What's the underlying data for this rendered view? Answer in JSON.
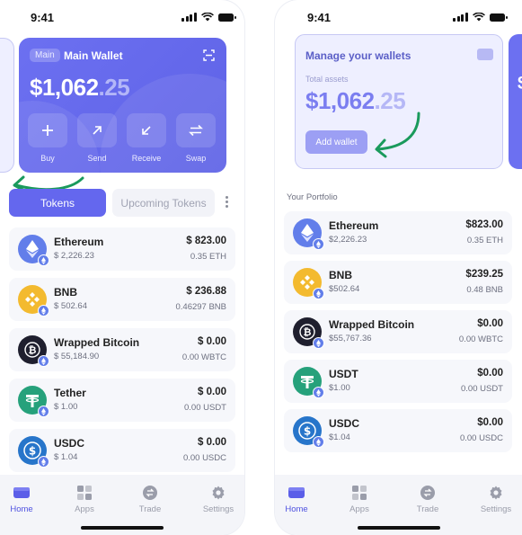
{
  "left": {
    "status": {
      "time": "9:41"
    },
    "wallet": {
      "badge": "Main",
      "name": "Main Wallet",
      "balance_int": "$1,062",
      "balance_dec": ".25",
      "actions": [
        {
          "label": "Buy",
          "icon": "plus-icon"
        },
        {
          "label": "Send",
          "icon": "arrow-up-right-icon"
        },
        {
          "label": "Receive",
          "icon": "arrow-down-left-icon"
        },
        {
          "label": "Swap",
          "icon": "swap-icon"
        }
      ]
    },
    "tabs": {
      "tokens": "Tokens",
      "upcoming": "Upcoming Tokens"
    },
    "tokens": [
      {
        "name": "Ethereum",
        "price": "$ 2,226.23",
        "value": "$ 823.00",
        "amount": "0.35 ETH",
        "color": "#627eea",
        "icon": "ethereum-icon"
      },
      {
        "name": "BNB",
        "price": "$ 502.64",
        "value": "$ 236.88",
        "amount": "0.46297 BNB",
        "color": "#f3ba2f",
        "icon": "bnb-icon"
      },
      {
        "name": "Wrapped Bitcoin",
        "price": "$ 55,184.90",
        "value": "$ 0.00",
        "amount": "0.00 WBTC",
        "color": "#1f1f2e",
        "icon": "bitcoin-icon"
      },
      {
        "name": "Tether",
        "price": "$ 1.00",
        "value": "$ 0.00",
        "amount": "0.00 USDT",
        "color": "#26a17b",
        "icon": "tether-icon"
      },
      {
        "name": "USDC",
        "price": "$ 1.04",
        "value": "$ 0.00",
        "amount": "0.00 USDC",
        "color": "#2775ca",
        "icon": "usdc-icon"
      }
    ],
    "nav": [
      {
        "label": "Home",
        "icon": "wallet-icon",
        "active": true
      },
      {
        "label": "Apps",
        "icon": "grid-icon",
        "active": false
      },
      {
        "label": "Trade",
        "icon": "trade-icon",
        "active": false
      },
      {
        "label": "Settings",
        "icon": "gear-icon",
        "active": false
      }
    ]
  },
  "right": {
    "status": {
      "time": "9:41"
    },
    "manage": {
      "title": "Manage your wallets",
      "total_label": "Total assets",
      "balance_int": "$1,062",
      "balance_dec": ".25",
      "add_wallet": "Add wallet"
    },
    "portfolio_label": "Your Portfolio",
    "tokens": [
      {
        "name": "Ethereum",
        "price": "$2,226.23",
        "value": "$823.00",
        "amount": "0.35 ETH",
        "color": "#627eea",
        "icon": "ethereum-icon"
      },
      {
        "name": "BNB",
        "price": "$502.64",
        "value": "$239.25",
        "amount": "0.48 BNB",
        "color": "#f3ba2f",
        "icon": "bnb-icon"
      },
      {
        "name": "Wrapped Bitcoin",
        "price": "$55,767.36",
        "value": "$0.00",
        "amount": "0.00 WBTC",
        "color": "#1f1f2e",
        "icon": "bitcoin-icon"
      },
      {
        "name": "USDT",
        "price": "$1.00",
        "value": "$0.00",
        "amount": "0.00 USDT",
        "color": "#26a17b",
        "icon": "tether-icon"
      },
      {
        "name": "USDC",
        "price": "$1.04",
        "value": "$0.00",
        "amount": "0.00 USDC",
        "color": "#2775ca",
        "icon": "usdc-icon"
      }
    ],
    "nav": [
      {
        "label": "Home",
        "icon": "wallet-icon",
        "active": true
      },
      {
        "label": "Apps",
        "icon": "grid-icon",
        "active": false
      },
      {
        "label": "Trade",
        "icon": "trade-icon",
        "active": false
      },
      {
        "label": "Settings",
        "icon": "gear-icon",
        "active": false
      }
    ]
  },
  "colors": {
    "accent": "#6467ee",
    "annotation_arrow": "#1a9a5c"
  }
}
